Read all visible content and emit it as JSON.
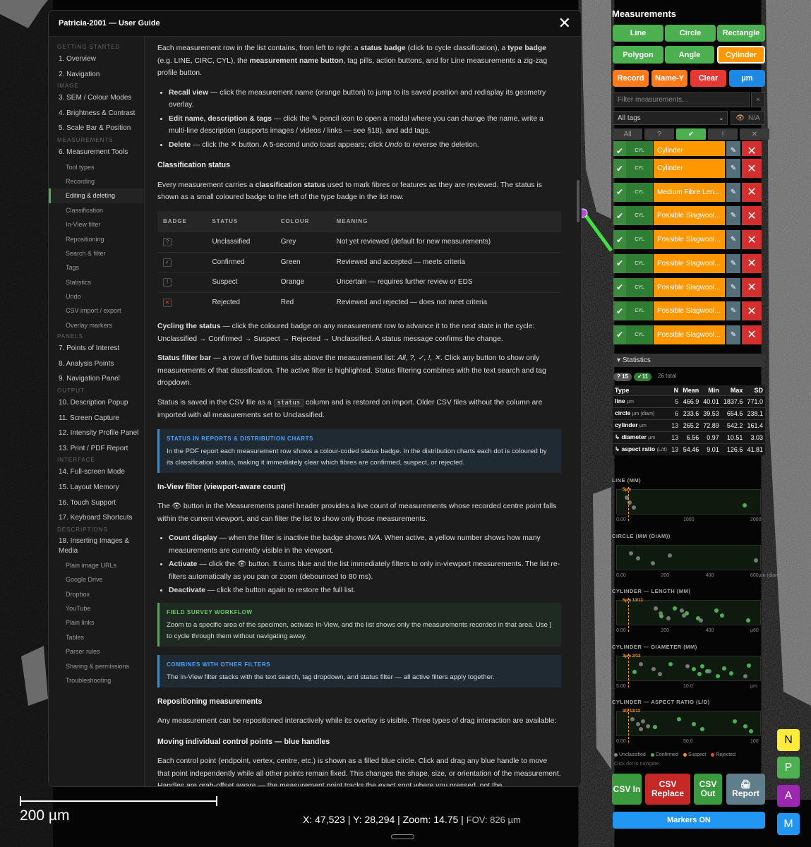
{
  "guide": {
    "title": "Patricia-2001 — User Guide",
    "toc": [
      {
        "kind": "sec",
        "label": "Getting Started"
      },
      {
        "kind": "it",
        "label": "1. Overview"
      },
      {
        "kind": "it",
        "label": "2. Navigation"
      },
      {
        "kind": "sec",
        "label": "Image"
      },
      {
        "kind": "it",
        "label": "3. SEM / Colour Modes"
      },
      {
        "kind": "it",
        "label": "4. Brightness & Contrast"
      },
      {
        "kind": "it",
        "label": "5. Scale Bar & Position"
      },
      {
        "kind": "sec",
        "label": "Measurements"
      },
      {
        "kind": "it",
        "label": "6. Measurement Tools"
      },
      {
        "kind": "sub",
        "label": "Tool types"
      },
      {
        "kind": "sub",
        "label": "Recording"
      },
      {
        "kind": "sub",
        "label": "Editing & deleting",
        "active": true
      },
      {
        "kind": "sub",
        "label": "Classification"
      },
      {
        "kind": "sub",
        "label": "In-View filter"
      },
      {
        "kind": "sub",
        "label": "Repositioning"
      },
      {
        "kind": "sub",
        "label": "Search & filter"
      },
      {
        "kind": "sub",
        "label": "Tags"
      },
      {
        "kind": "sub",
        "label": "Statistics"
      },
      {
        "kind": "sub",
        "label": "Undo"
      },
      {
        "kind": "sub",
        "label": "CSV import / export"
      },
      {
        "kind": "sub",
        "label": "Overlay markers"
      },
      {
        "kind": "sec",
        "label": "Panels"
      },
      {
        "kind": "it",
        "label": "7. Points of Interest"
      },
      {
        "kind": "it",
        "label": "8. Analysis Points"
      },
      {
        "kind": "it",
        "label": "9. Navigation Panel"
      },
      {
        "kind": "sec",
        "label": "Output"
      },
      {
        "kind": "it",
        "label": "10. Description Popup"
      },
      {
        "kind": "it",
        "label": "11. Screen Capture"
      },
      {
        "kind": "it",
        "label": "12. Intensity Profile Panel"
      },
      {
        "kind": "it",
        "label": "13. Print / PDF Report"
      },
      {
        "kind": "sec",
        "label": "Interface"
      },
      {
        "kind": "it",
        "label": "14. Full-screen Mode"
      },
      {
        "kind": "it",
        "label": "15. Layout Memory"
      },
      {
        "kind": "it",
        "label": "16. Touch Support"
      },
      {
        "kind": "it",
        "label": "17. Keyboard Shortcuts"
      },
      {
        "kind": "sec",
        "label": "Descriptions"
      },
      {
        "kind": "it",
        "label": "18. Inserting Images & Media",
        "tall": true
      },
      {
        "kind": "sub",
        "label": "Plain image URLs"
      },
      {
        "kind": "sub",
        "label": "Google Drive"
      },
      {
        "kind": "sub",
        "label": "Dropbox"
      },
      {
        "kind": "sub",
        "label": "YouTube"
      },
      {
        "kind": "sub",
        "label": "Plain links"
      },
      {
        "kind": "sub",
        "label": "Tables"
      },
      {
        "kind": "sub",
        "label": "Parser rules"
      },
      {
        "kind": "sub",
        "label": "Sharing & permissions"
      },
      {
        "kind": "sub",
        "label": "Troubleshooting"
      }
    ],
    "p1": {
      "a": "Each measurement row in the list contains, from left to right: a ",
      "b1": "status badge",
      "c": " (click to cycle classification), a ",
      "b2": "type badge",
      "d": " (e.g. LINE, CIRC, CYL), the ",
      "b3": "measurement name button",
      "e": ", tag pills, action buttons, and for Line measurements a zig-zag profile button."
    },
    "bullets1": [
      {
        "b": "Recall view",
        "t": " — click the measurement name (orange button) to jump to its saved position and redisplay its geometry overlay."
      },
      {
        "b": "Edit name, description & tags",
        "t": " — click the ✎ pencil icon to open a modal where you can change the name, write a multi-line description (supports images / videos / links — see §18), and add tags."
      },
      {
        "b": "Delete",
        "t": " — click the ✕ button. A 5-second undo toast appears; click ",
        "i": "Undo",
        "t2": " to reverse the deletion."
      }
    ],
    "h_class": "Classification status",
    "p2": {
      "a": "Every measurement carries a ",
      "b": "classification status",
      "c": " used to mark fibres or features as they are reviewed. The status is shown as a small coloured badge to the left of the type badge in the list row."
    },
    "table": {
      "headers": [
        "BADGE",
        "STATUS",
        "COLOUR",
        "MEANING"
      ],
      "rows": [
        {
          "badge": "?",
          "status": "Unclassified",
          "colour": "Grey",
          "meaning": "Not yet reviewed (default for new measurements)",
          "bc": "#888"
        },
        {
          "badge": "✓",
          "status": "Confirmed",
          "colour": "Green",
          "meaning": "Reviewed and accepted — meets criteria",
          "bc": "#4caf50"
        },
        {
          "badge": "!",
          "status": "Suspect",
          "colour": "Orange",
          "meaning": "Uncertain — requires further review or EDS",
          "bc": "#ff9800"
        },
        {
          "badge": "✕",
          "status": "Rejected",
          "colour": "Red",
          "meaning": "Reviewed and rejected — does not meet criteria",
          "bc": "#f44336"
        }
      ]
    },
    "p3": {
      "b": "Cycling the status",
      "t": " — click the coloured badge on any measurement row to advance it to the next state in the cycle: Unclassified → Confirmed → Suspect → Rejected → Unclassified. A status message confirms the change."
    },
    "p4": {
      "b": "Status filter bar",
      "t": " — a row of five buttons sits above the measurement list: ",
      "i": "All, ?, ✓, !, ✕",
      "t2": ". Click any button to show only measurements of that classification. The active filter is highlighted. Status filtering combines with the text search and tag dropdown."
    },
    "p5": {
      "a": "Status is saved in the CSV file as a ",
      "code": "status",
      "b": " column and is restored on import. Older CSV files without the column are imported with all measurements set to Unclassified."
    },
    "call1": {
      "head": "STATUS IN REPORTS & DISTRIBUTION CHARTS",
      "text": "In the PDF report each measurement row shows a colour-coded status badge. In the distribution charts each dot is coloured by its classification status, making it immediately clear which fibres are confirmed, suspect, or rejected."
    },
    "h_inview": "In-View filter (viewport-aware count)",
    "p6": {
      "a": "The 👁 button in the Measurements panel header provides a live count of measurements whose recorded centre point falls within the current viewport, and can filter the list to show only those measurements."
    },
    "bullets2": [
      {
        "b": "Count display",
        "t": " — when the filter is inactive the badge shows ",
        "i": "N/A",
        "t2": ". When active, a yellow number shows how many measurements are currently visible in the viewport."
      },
      {
        "b": "Activate",
        "t": " — click the 👁 button. It turns blue and the list immediately filters to only in-viewport measurements. The list re-filters automatically as you pan or zoom (debounced to 80 ms).",
        "i": "",
        "t2": ""
      },
      {
        "b": "Deactivate",
        "t": " — click the button again to restore the full list.",
        "i": "",
        "t2": ""
      }
    ],
    "call2": {
      "head": "FIELD SURVEY WORKFLOW",
      "text": "Zoom to a specific area of the specimen, activate In-View, and the list shows only the measurements recorded in that area. Use ] to cycle through them without navigating away."
    },
    "call3": {
      "head": "COMBINES WITH OTHER FILTERS",
      "text": "The In-View filter stacks with the text search, tag dropdown, and status filter — all active filters apply together."
    },
    "h_repos": "Repositioning measurements",
    "p7": "Any measurement can be repositioned interactively while its overlay is visible. Three types of drag interaction are available:",
    "h_moving": "Moving individual control points — blue handles",
    "p8": "Each control point (endpoint, vertex, centre, etc.) is shown as a filled blue circle. Click and drag any blue handle to move that point independently while all other points remain fixed. This changes the shape, size, or orientation of the measurement. Handles are grab-offset aware — the measurement point tracks the exact spot where you pressed, not the"
  },
  "viewer": {
    "scale_label": "200 µm",
    "coords": "X: 47,523 | Y: 28,294 | Zoom: 14.75 |",
    "fov": "FOV: 826 µm"
  },
  "panel": {
    "title": "Measurements",
    "tools": [
      "Line",
      "Circle",
      "Rectangle",
      "Polygon",
      "Angle",
      "Cylinder"
    ],
    "actions": [
      {
        "label": "Record",
        "color": "#ff7a1a"
      },
      {
        "label": "Name-Y",
        "color": "#ff7a1a"
      },
      {
        "label": "Clear",
        "color": "#e53935"
      },
      {
        "label": "µm",
        "color": "#1e88e5"
      }
    ],
    "filter_placeholder": "Filter measurements...",
    "clear_x": "×",
    "tags_select": "All tags",
    "inview_label": "N/A",
    "status_filters": [
      "All",
      "?",
      "✔",
      "!",
      "✕"
    ],
    "rows": [
      {
        "type": "CYL",
        "name": "Cylinder"
      },
      {
        "type": "CYL",
        "name": "Cylinder"
      },
      {
        "type": "CYL",
        "name": "Medium Fibre Len..."
      },
      {
        "type": "CYL",
        "name": "Possible Slagwool..."
      },
      {
        "type": "CYL",
        "name": "Possible Slagwool..."
      },
      {
        "type": "CYL",
        "name": "Possible Slagwool..."
      },
      {
        "type": "CYL",
        "name": "Possible Slagwool..."
      },
      {
        "type": "CYL",
        "name": "Possible Slagwool..."
      },
      {
        "type": "CYL",
        "name": "Possible Slagwool..."
      }
    ],
    "statistics_label": "Statistics",
    "pill_q": "? 15",
    "pill_ok": "✓11",
    "total": "26 total",
    "stats_headers": [
      "Type",
      "N",
      "Mean",
      "Min",
      "Max",
      "SD"
    ],
    "stats_rows": [
      {
        "type": "line",
        "unit": "µm",
        "n": "5",
        "mean": "466.9",
        "min": "40.01",
        "max": "1837.6",
        "sd": "771.0"
      },
      {
        "type": "circle",
        "unit": "µm (diam)",
        "n": "6",
        "mean": "233.6",
        "min": "39.53",
        "max": "654.6",
        "sd": "238.1"
      },
      {
        "type": "cylinder",
        "unit": "µm",
        "n": "13",
        "mean": "265.2",
        "min": "72.89",
        "max": "542.2",
        "sd": "161.4"
      },
      {
        "type": "↳ diameter",
        "unit": "µm",
        "n": "13",
        "mean": "6.56",
        "min": "0.97",
        "max": "10.51",
        "sd": "3.03"
      },
      {
        "type": "↳ aspect ratio",
        "unit": "(L/d)",
        "n": "13",
        "mean": "54.46",
        "min": "9.01",
        "max": "126.6",
        "sd": "41.81"
      }
    ],
    "legend": [
      "Unclassified",
      "Confirmed",
      "Suspect",
      "Rejected"
    ],
    "legend_colors": [
      "#888888",
      "#4caf50",
      "#ff9800",
      "#f44336"
    ],
    "click_hint": "Click dot to navigate",
    "bottom_buttons": [
      {
        "label": "CSV In",
        "color": "#3a9a3e"
      },
      {
        "label": "CSV Replace",
        "color": "#c62828"
      },
      {
        "label": "CSV Out",
        "color": "#3a9a3e"
      },
      {
        "label": "🖨 Report",
        "color": "#607d8b"
      }
    ],
    "markers": "Markers ON",
    "side_buttons": [
      {
        "label": "N",
        "bg": "#ffeb3b",
        "fg": "#000"
      },
      {
        "label": "P",
        "bg": "#4caf50",
        "fg": "#fff"
      },
      {
        "label": "A",
        "bg": "#9c27b0",
        "fg": "#fff"
      },
      {
        "label": "M",
        "bg": "#2196f3",
        "fg": "#fff"
      }
    ]
  },
  "chart_data": [
    {
      "type": "scatter",
      "title": "LINE (MM)",
      "xlim": [
        0,
        2000
      ],
      "ticks": [
        "0.00",
        "1000",
        "2000"
      ],
      "marker_label": "5µm",
      "series": [
        {
          "name": "Unclassified",
          "x": [
            60,
            110,
            170
          ]
        },
        {
          "name": "Confirmed",
          "x": [
            1838
          ]
        }
      ]
    },
    {
      "type": "scatter",
      "title": "CIRCLE (MM (DIAM))",
      "xlim": [
        0,
        650
      ],
      "ticks": [
        "0.00",
        "200",
        "400",
        "600µm (diam)"
      ],
      "series": [
        {
          "name": "Unclassified",
          "x": [
            40,
            75,
            150,
            230,
            655
          ]
        }
      ]
    },
    {
      "type": "scatter",
      "title": "CYLINDER — LENGTH (MM)",
      "xlim": [
        0,
        560
      ],
      "ticks": [
        "0.00",
        "200",
        "400",
        "µ60"
      ],
      "marker_label": "5µm 13/13",
      "series": [
        {
          "name": "Unclassified",
          "x": [
            140,
            160,
            195,
            250,
            260,
            330
          ]
        },
        {
          "name": "Confirmed",
          "x": [
            165,
            220,
            270,
            320,
            395,
            420,
            530
          ]
        }
      ]
    },
    {
      "type": "scatter",
      "title": "CYLINDER — DIAMETER (MM)",
      "xlim": [
        0,
        11
      ],
      "ticks": [
        "5.00",
        "10.0",
        "µm"
      ],
      "marker_label": "3µm 2/13",
      "series": [
        {
          "name": "Unclassified",
          "x": [
            1.5,
            2.6,
            3.1,
            5.4,
            7.2,
            10.2
          ]
        },
        {
          "name": "Confirmed",
          "x": [
            0.97,
            4.0,
            5.9,
            6.4,
            6.6,
            7.0,
            7.9,
            8.4,
            9.0,
            10.5
          ]
        }
      ]
    },
    {
      "type": "scatter",
      "title": "CYLINDER — ASPECT RATIO (L/D)",
      "xlim": [
        0,
        130
      ],
      "ticks": [
        "0.00",
        "50.0",
        "100"
      ],
      "marker_label": "3/1 13/13",
      "series": [
        {
          "name": "Unclassified",
          "x": [
            10,
            15,
            18,
            20,
            25
          ]
        },
        {
          "name": "Confirmed",
          "x": [
            32,
            55,
            70,
            78,
            110,
            120,
            126
          ]
        }
      ]
    }
  ]
}
